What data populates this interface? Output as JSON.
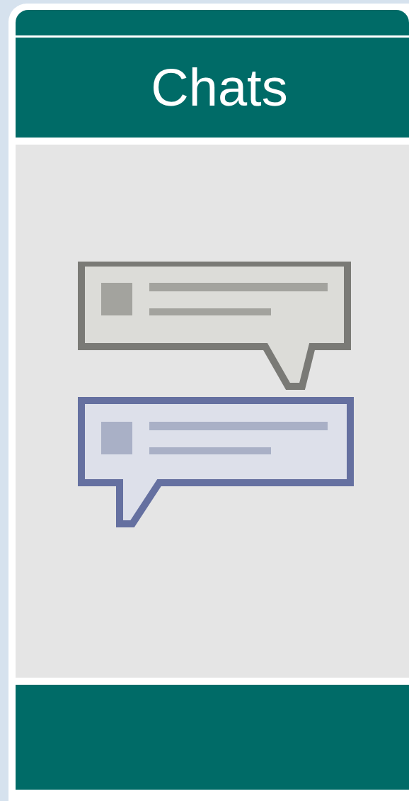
{
  "header": {
    "title": "Chats"
  }
}
